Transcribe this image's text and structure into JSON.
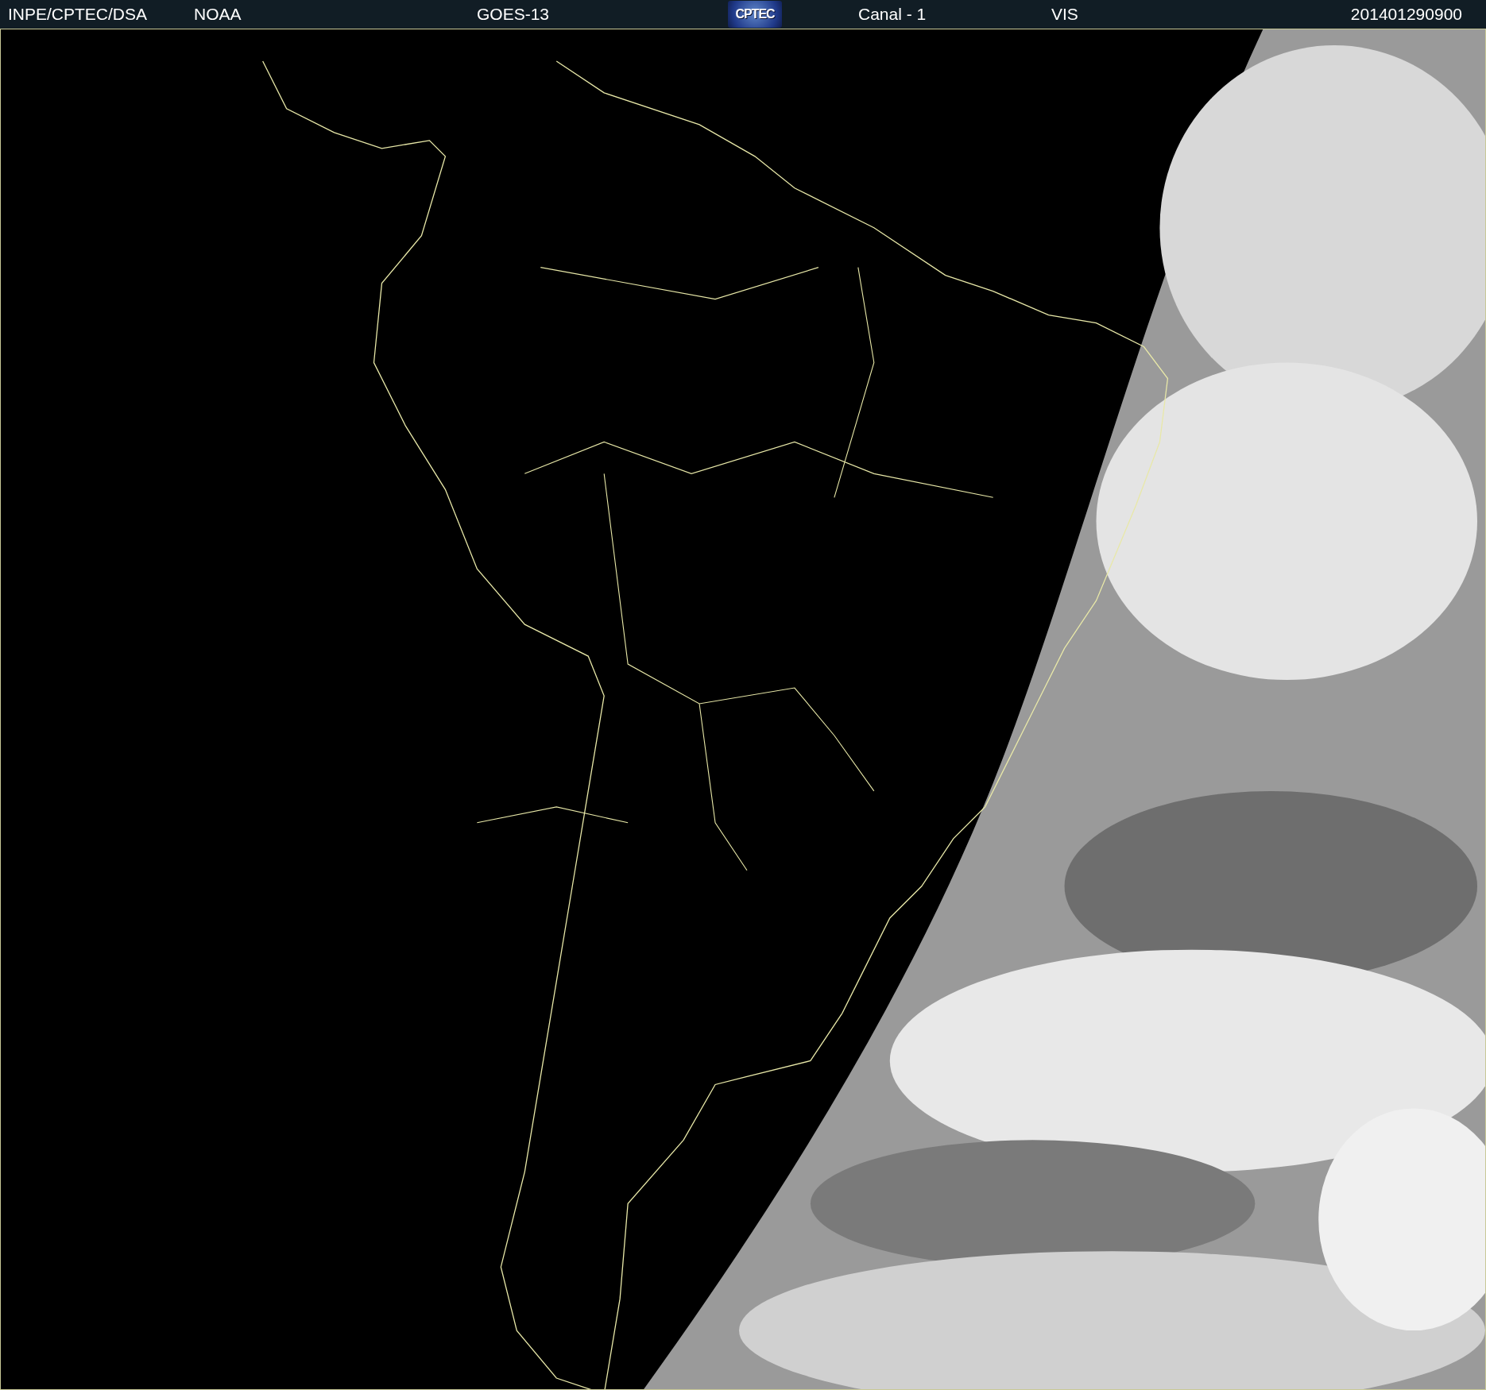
{
  "header": {
    "items": [
      {
        "kind": "text",
        "label": "INPE/CPTEC/DSA"
      },
      {
        "kind": "text",
        "label": "NOAA"
      },
      {
        "kind": "text",
        "label": "GOES-13"
      },
      {
        "kind": "logo",
        "label": "CPTEC"
      },
      {
        "kind": "text",
        "label": "Canal - 1"
      },
      {
        "kind": "text",
        "label": "VIS"
      },
      {
        "kind": "text",
        "label": "201401290900"
      }
    ]
  }
}
